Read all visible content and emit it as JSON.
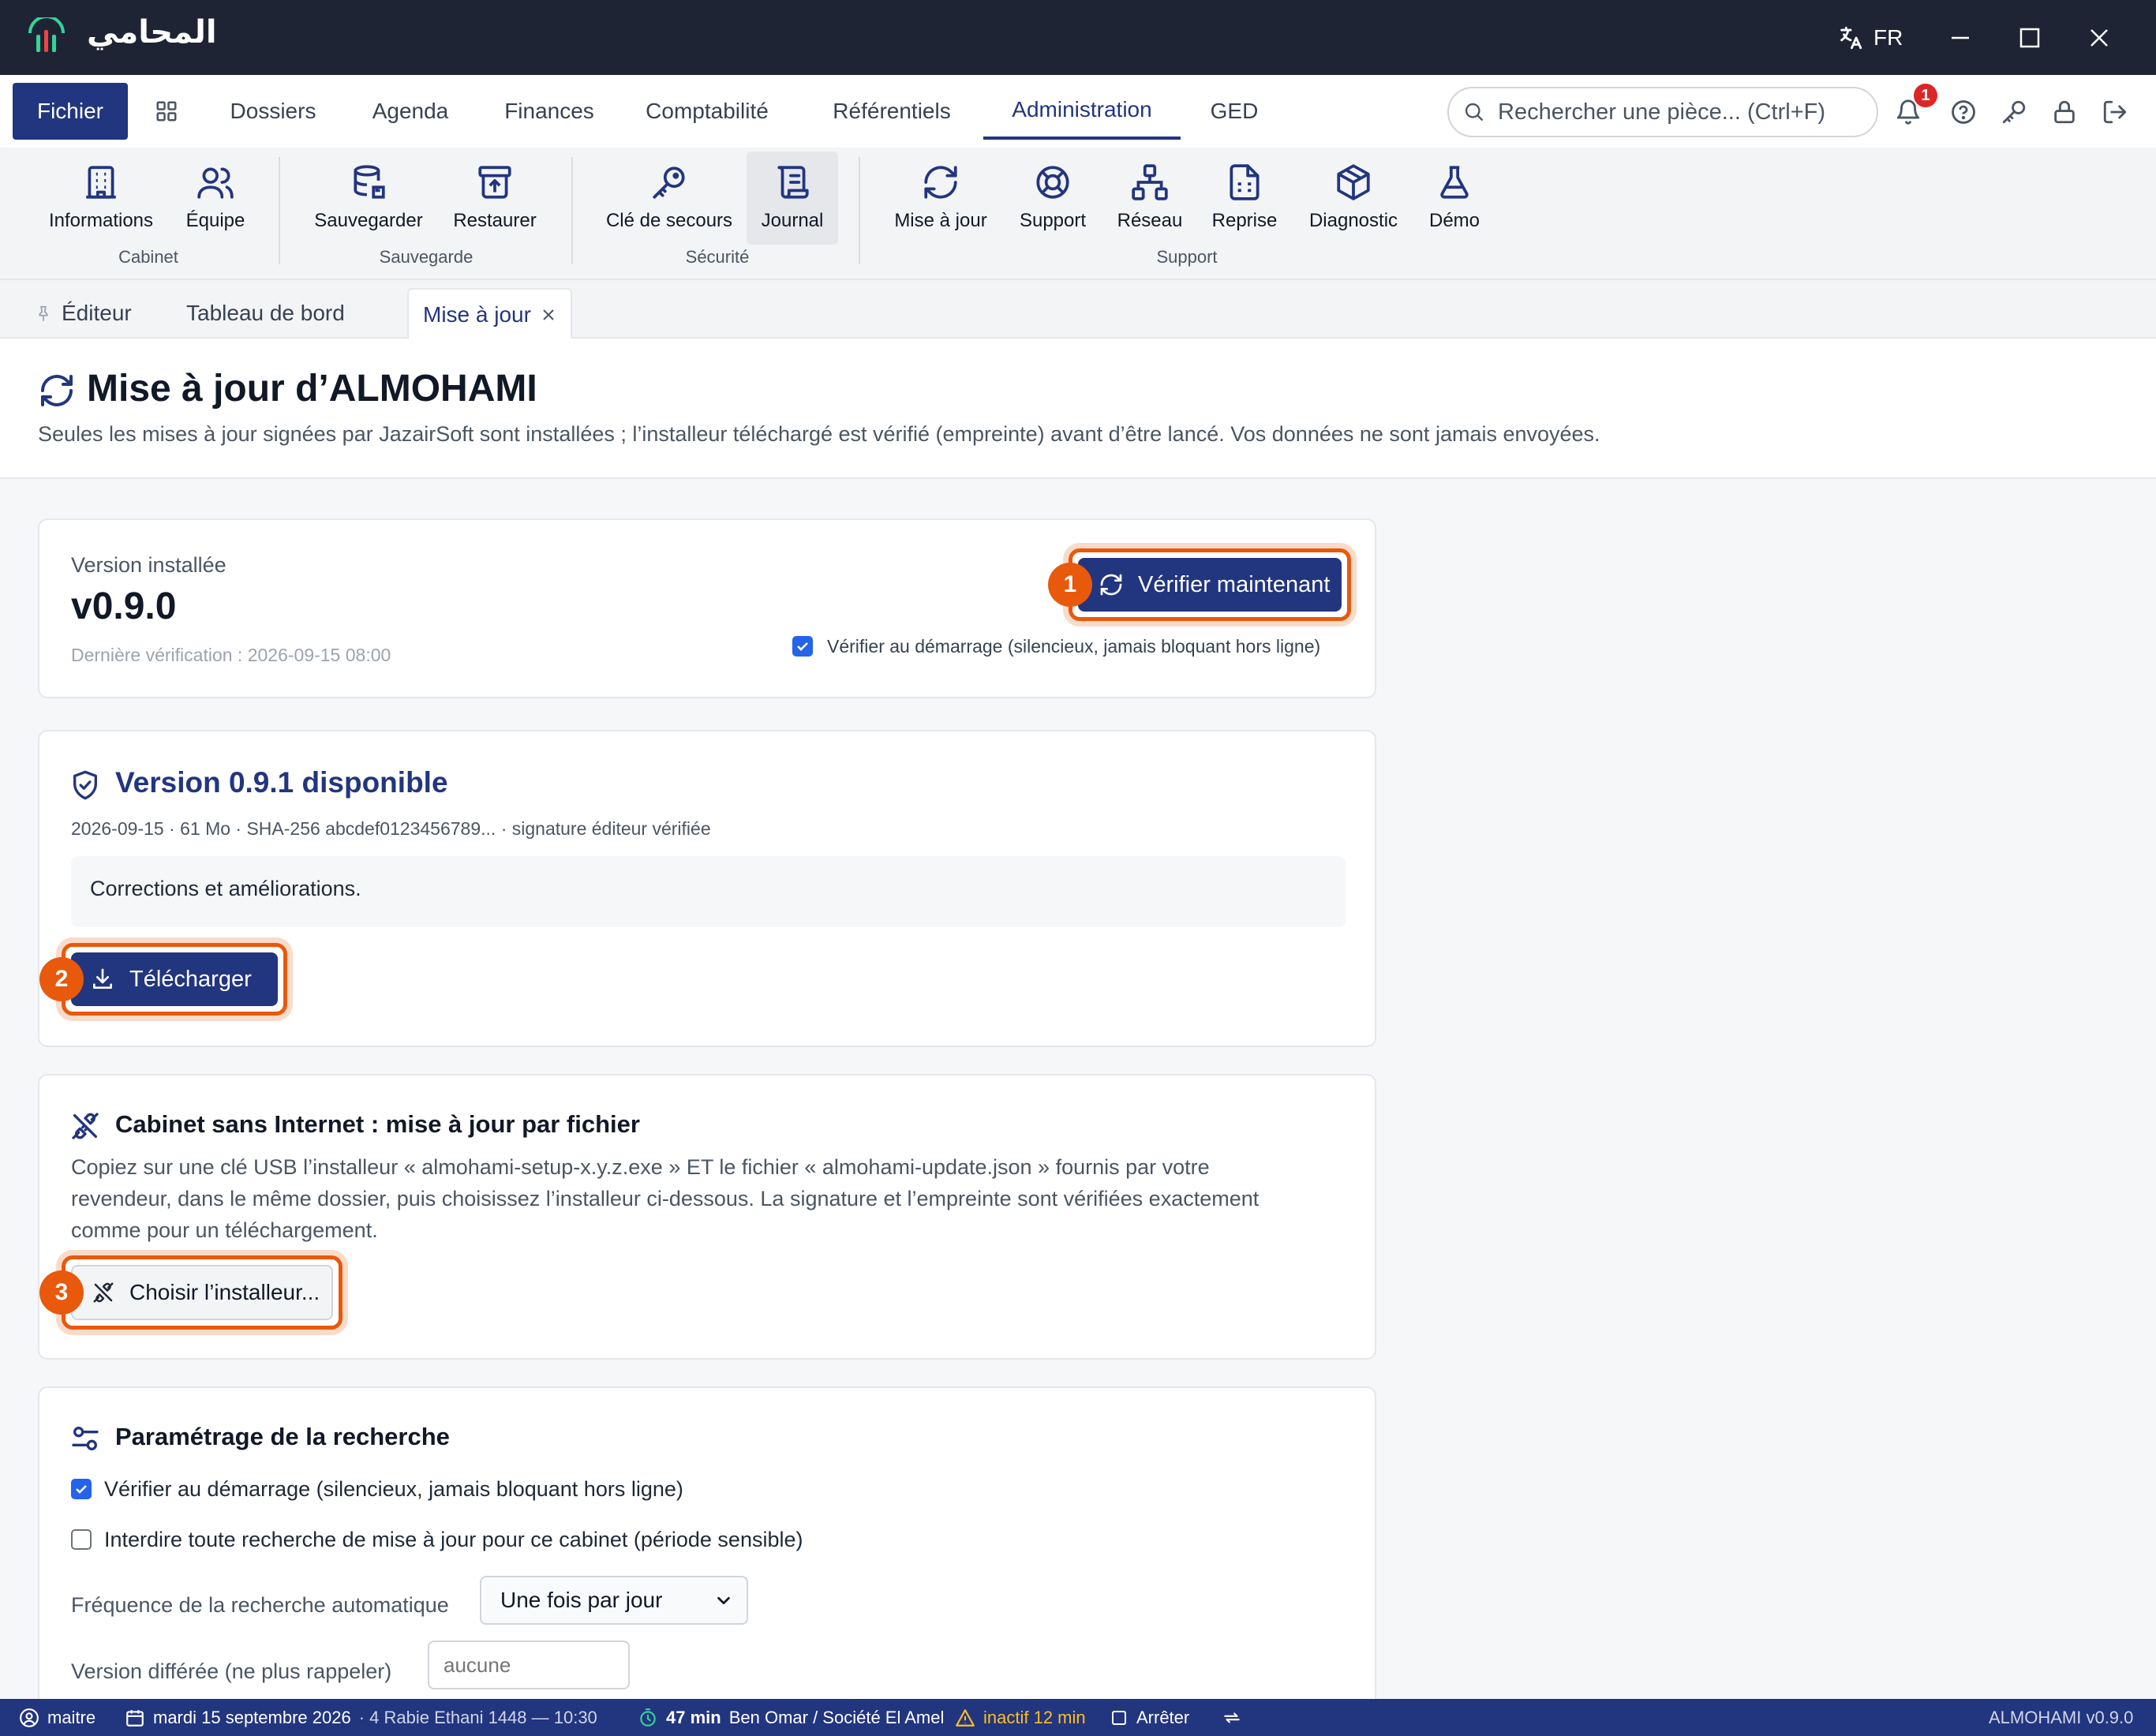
{
  "titlebar": {
    "app_name": "المحامي",
    "lang": "FR"
  },
  "menu": {
    "file": "Fichier",
    "tabs": [
      "Dossiers",
      "Agenda",
      "Finances",
      "Comptabilité",
      "Référentiels",
      "Administration",
      "GED"
    ],
    "active_tab": "Administration",
    "search_placeholder": "Rechercher une pièce... (Ctrl+F)",
    "notification_count": "1"
  },
  "ribbon": {
    "groups": [
      {
        "label": "Cabinet",
        "items": [
          "Informations",
          "Équipe"
        ]
      },
      {
        "label": "Sauvegarde",
        "items": [
          "Sauvegarder",
          "Restaurer"
        ]
      },
      {
        "label": "Sécurité",
        "items": [
          "Clé de secours",
          "Journal"
        ]
      },
      {
        "label": "Support",
        "items": [
          "Mise à jour",
          "Support",
          "Réseau",
          "Reprise",
          "Diagnostic",
          "Démo"
        ]
      }
    ],
    "selected_item": "Journal"
  },
  "doc_tabs": {
    "pinned": "Éditeur",
    "dashboard": "Tableau de bord",
    "active": "Mise à jour"
  },
  "page": {
    "title": "Mise à jour d’ALMOHAMI",
    "description": "Seules les mises à jour signées par JazairSoft sont installées ; l’installeur téléchargé est vérifié (empreinte) avant d’être lancé. Vos données ne sont jamais envoyées."
  },
  "installed": {
    "label": "Version installée",
    "version": "v0.9.0",
    "last_check": "Dernière vérification : 2026-09-15 08:00",
    "check_button": "Vérifier maintenant",
    "check_on_start": "Vérifier au démarrage (silencieux, jamais bloquant hors ligne)",
    "check_on_start_checked": true
  },
  "available": {
    "title": "Version 0.9.1 disponible",
    "meta": "2026-09-15 · 61 Mo · SHA-256 abcdef0123456789... · signature éditeur vérifiée",
    "notes": "Corrections et améliorations.",
    "download_button": "Télécharger"
  },
  "offline": {
    "title": "Cabinet sans Internet : mise à jour par fichier",
    "line1": "Copiez sur une clé USB l’installeur « almohami-setup-x.y.z.exe » ET le fichier « almohami-update.json » fournis par votre",
    "line2": "revendeur, dans le même dossier, puis choisissez l’installeur ci-dessous. La signature et l’empreinte sont vérifiées exactement",
    "line3": "comme pour un téléchargement.",
    "choose_button": "Choisir l’installeur..."
  },
  "settings": {
    "title": "Paramétrage de la recherche",
    "check_on_start": "Vérifier au démarrage (silencieux, jamais bloquant hors ligne)",
    "check_on_start_checked": true,
    "forbid": "Interdire toute recherche de mise à jour pour ce cabinet (période sensible)",
    "forbid_checked": false,
    "frequency_label": "Fréquence de la recherche automatique",
    "frequency_value": "Une fois par jour",
    "deferred_label": "Version différée (ne plus rappeler)",
    "deferred_placeholder": "aucune"
  },
  "steps": [
    "1",
    "2",
    "3"
  ],
  "statusbar": {
    "user": "maitre",
    "date": "mardi 15 septembre 2026",
    "hijri_time": "· 4 Rabie Ethani 1448 — 10:30",
    "timer": "47 min",
    "client": "Ben Omar / Société El Amel",
    "inactive": "inactif 12 min",
    "stop": "Arrêter",
    "version": "ALMOHAMI v0.9.0"
  },
  "colors": {
    "brand_navy": "#22357f",
    "titlebar": "#1e2433",
    "highlight_orange": "#e8590c",
    "checkbox_blue": "#2563eb",
    "notification_red": "#dc2626",
    "warning_amber": "#fbbf24"
  }
}
